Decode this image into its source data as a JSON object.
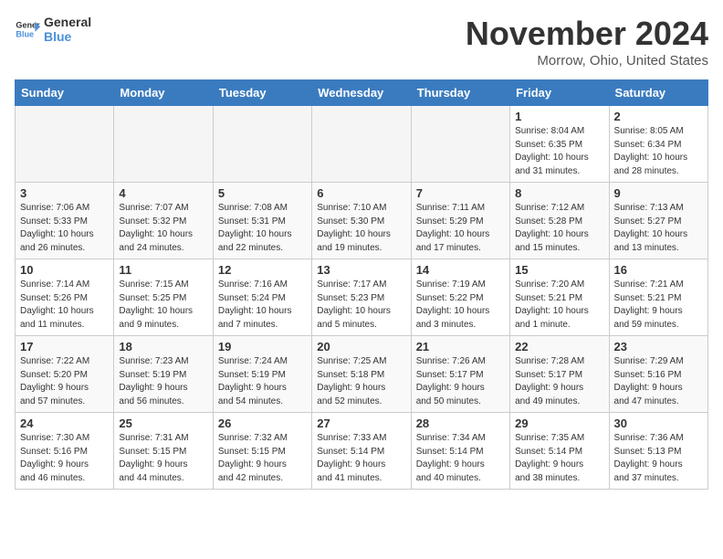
{
  "header": {
    "logo_line1": "General",
    "logo_line2": "Blue",
    "month": "November 2024",
    "location": "Morrow, Ohio, United States"
  },
  "weekdays": [
    "Sunday",
    "Monday",
    "Tuesday",
    "Wednesday",
    "Thursday",
    "Friday",
    "Saturday"
  ],
  "weeks": [
    [
      {
        "day": "",
        "info": ""
      },
      {
        "day": "",
        "info": ""
      },
      {
        "day": "",
        "info": ""
      },
      {
        "day": "",
        "info": ""
      },
      {
        "day": "",
        "info": ""
      },
      {
        "day": "1",
        "info": "Sunrise: 8:04 AM\nSunset: 6:35 PM\nDaylight: 10 hours\nand 31 minutes."
      },
      {
        "day": "2",
        "info": "Sunrise: 8:05 AM\nSunset: 6:34 PM\nDaylight: 10 hours\nand 28 minutes."
      }
    ],
    [
      {
        "day": "3",
        "info": "Sunrise: 7:06 AM\nSunset: 5:33 PM\nDaylight: 10 hours\nand 26 minutes."
      },
      {
        "day": "4",
        "info": "Sunrise: 7:07 AM\nSunset: 5:32 PM\nDaylight: 10 hours\nand 24 minutes."
      },
      {
        "day": "5",
        "info": "Sunrise: 7:08 AM\nSunset: 5:31 PM\nDaylight: 10 hours\nand 22 minutes."
      },
      {
        "day": "6",
        "info": "Sunrise: 7:10 AM\nSunset: 5:30 PM\nDaylight: 10 hours\nand 19 minutes."
      },
      {
        "day": "7",
        "info": "Sunrise: 7:11 AM\nSunset: 5:29 PM\nDaylight: 10 hours\nand 17 minutes."
      },
      {
        "day": "8",
        "info": "Sunrise: 7:12 AM\nSunset: 5:28 PM\nDaylight: 10 hours\nand 15 minutes."
      },
      {
        "day": "9",
        "info": "Sunrise: 7:13 AM\nSunset: 5:27 PM\nDaylight: 10 hours\nand 13 minutes."
      }
    ],
    [
      {
        "day": "10",
        "info": "Sunrise: 7:14 AM\nSunset: 5:26 PM\nDaylight: 10 hours\nand 11 minutes."
      },
      {
        "day": "11",
        "info": "Sunrise: 7:15 AM\nSunset: 5:25 PM\nDaylight: 10 hours\nand 9 minutes."
      },
      {
        "day": "12",
        "info": "Sunrise: 7:16 AM\nSunset: 5:24 PM\nDaylight: 10 hours\nand 7 minutes."
      },
      {
        "day": "13",
        "info": "Sunrise: 7:17 AM\nSunset: 5:23 PM\nDaylight: 10 hours\nand 5 minutes."
      },
      {
        "day": "14",
        "info": "Sunrise: 7:19 AM\nSunset: 5:22 PM\nDaylight: 10 hours\nand 3 minutes."
      },
      {
        "day": "15",
        "info": "Sunrise: 7:20 AM\nSunset: 5:21 PM\nDaylight: 10 hours\nand 1 minute."
      },
      {
        "day": "16",
        "info": "Sunrise: 7:21 AM\nSunset: 5:21 PM\nDaylight: 9 hours\nand 59 minutes."
      }
    ],
    [
      {
        "day": "17",
        "info": "Sunrise: 7:22 AM\nSunset: 5:20 PM\nDaylight: 9 hours\nand 57 minutes."
      },
      {
        "day": "18",
        "info": "Sunrise: 7:23 AM\nSunset: 5:19 PM\nDaylight: 9 hours\nand 56 minutes."
      },
      {
        "day": "19",
        "info": "Sunrise: 7:24 AM\nSunset: 5:19 PM\nDaylight: 9 hours\nand 54 minutes."
      },
      {
        "day": "20",
        "info": "Sunrise: 7:25 AM\nSunset: 5:18 PM\nDaylight: 9 hours\nand 52 minutes."
      },
      {
        "day": "21",
        "info": "Sunrise: 7:26 AM\nSunset: 5:17 PM\nDaylight: 9 hours\nand 50 minutes."
      },
      {
        "day": "22",
        "info": "Sunrise: 7:28 AM\nSunset: 5:17 PM\nDaylight: 9 hours\nand 49 minutes."
      },
      {
        "day": "23",
        "info": "Sunrise: 7:29 AM\nSunset: 5:16 PM\nDaylight: 9 hours\nand 47 minutes."
      }
    ],
    [
      {
        "day": "24",
        "info": "Sunrise: 7:30 AM\nSunset: 5:16 PM\nDaylight: 9 hours\nand 46 minutes."
      },
      {
        "day": "25",
        "info": "Sunrise: 7:31 AM\nSunset: 5:15 PM\nDaylight: 9 hours\nand 44 minutes."
      },
      {
        "day": "26",
        "info": "Sunrise: 7:32 AM\nSunset: 5:15 PM\nDaylight: 9 hours\nand 42 minutes."
      },
      {
        "day": "27",
        "info": "Sunrise: 7:33 AM\nSunset: 5:14 PM\nDaylight: 9 hours\nand 41 minutes."
      },
      {
        "day": "28",
        "info": "Sunrise: 7:34 AM\nSunset: 5:14 PM\nDaylight: 9 hours\nand 40 minutes."
      },
      {
        "day": "29",
        "info": "Sunrise: 7:35 AM\nSunset: 5:14 PM\nDaylight: 9 hours\nand 38 minutes."
      },
      {
        "day": "30",
        "info": "Sunrise: 7:36 AM\nSunset: 5:13 PM\nDaylight: 9 hours\nand 37 minutes."
      }
    ]
  ]
}
